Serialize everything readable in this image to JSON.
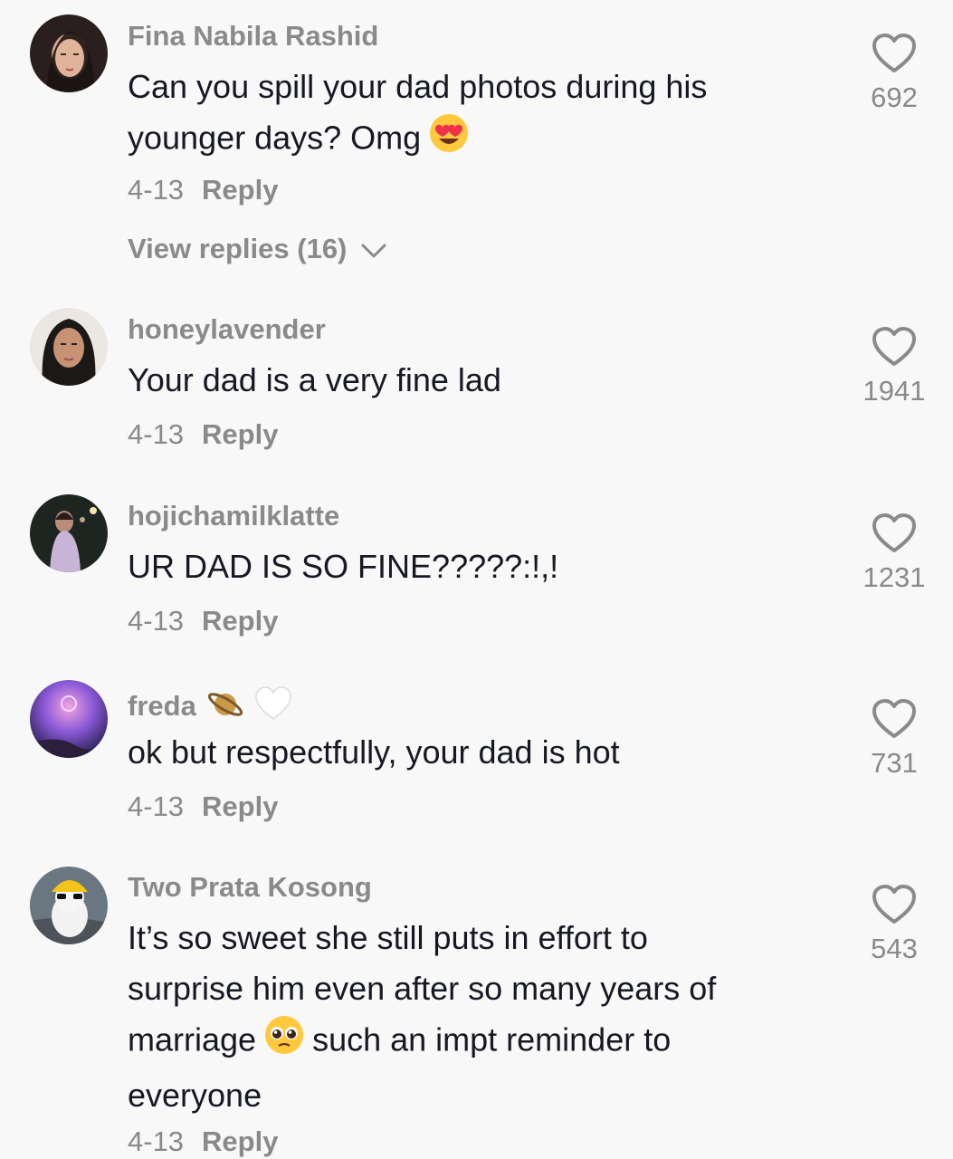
{
  "comments": [
    {
      "username": "Fina Nabila Rashid",
      "text_1": "Can you spill your dad photos during his",
      "text_2": "younger days? Omg",
      "emoji": "heart-eyes-emoji",
      "date": "4-13",
      "reply": "Reply",
      "likes": "692",
      "view_replies": "View replies (16)"
    },
    {
      "username": "honeylavender",
      "text": "Your dad is a very fine lad",
      "date": "4-13",
      "reply": "Reply",
      "likes": "1941"
    },
    {
      "username": "hojichamilklatte",
      "text": "UR DAD IS SO FINE?????:!,!",
      "date": "4-13",
      "reply": "Reply",
      "likes": "1231"
    },
    {
      "username": "freda",
      "username_emojis": [
        "ringed-planet-emoji",
        "white-heart-emoji"
      ],
      "text": "ok but respectfully, your dad is hot",
      "date": "4-13",
      "reply": "Reply",
      "likes": "731"
    },
    {
      "username": "Two Prata Kosong",
      "text_1": "It’s so sweet she still puts in effort to",
      "text_2": "surprise him even after so many years of",
      "text_3a": "marriage",
      "emoji": "pleading-face-emoji",
      "text_3b": "such an impt reminder to",
      "text_4": "everyone",
      "date": "4-13",
      "reply": "Reply",
      "likes": "543"
    }
  ],
  "colors": {
    "background": "#f8f8f8",
    "text": "#161823",
    "secondary": "#8a8a8a"
  }
}
